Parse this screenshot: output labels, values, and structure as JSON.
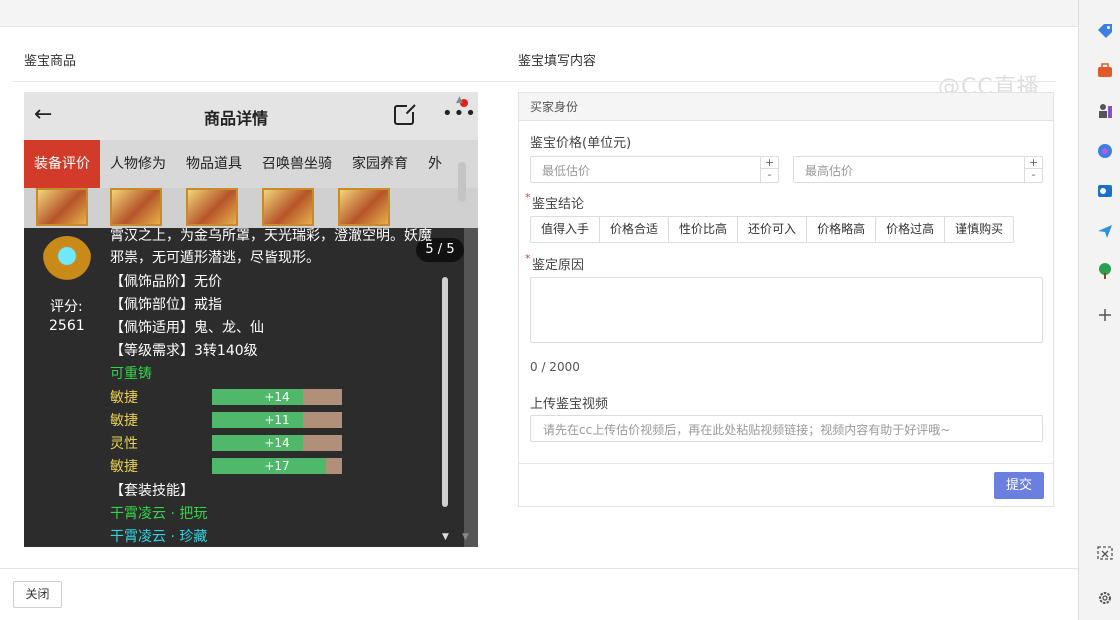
{
  "dialog": {
    "left_title": "鉴宝商品",
    "right_title": "鉴宝填写内容",
    "close_label": "关闭",
    "watermark": "@CC直播"
  },
  "phone": {
    "title": "商品详情",
    "tabs": [
      "装备评价",
      "人物修为",
      "物品道具",
      "召唤兽坐骑",
      "家园养育",
      "外"
    ],
    "active_tab": "装备评价"
  },
  "tooltip": {
    "description": "霄汉之上，为金乌所罩，天光瑞彩，澄澈空明。妖魔邪祟，无可遁形潜逃，尽皆现形。",
    "counter": "5 / 5",
    "score_label": "评分:",
    "score_value": "2561",
    "props": [
      "【佩饰品阶】无价",
      "【佩饰部位】戒指",
      "【佩饰适用】鬼、龙、仙",
      "【等级需求】3转140级"
    ],
    "recast": "可重铸",
    "stats": [
      {
        "name": "敏捷",
        "value": "+14",
        "fill": 0.7
      },
      {
        "name": "敏捷",
        "value": "+11",
        "fill": 0.7
      },
      {
        "name": "灵性",
        "value": "+14",
        "fill": 0.7
      },
      {
        "name": "敏捷",
        "value": "+17",
        "fill": 0.88
      }
    ],
    "set_title": "【套装技能】",
    "set_skills": [
      "干霄凌云 · 把玩",
      "干霄凌云 · 珍藏"
    ]
  },
  "form": {
    "section": "买家身份",
    "price_label": "鉴宝价格(单位元)",
    "min_placeholder": "最低估价",
    "max_placeholder": "最高估价",
    "conclusion_label": "鉴宝结论",
    "conclusions": [
      "值得入手",
      "价格合适",
      "性价比高",
      "还价可入",
      "价格略高",
      "价格过高",
      "谨慎购买"
    ],
    "reason_label": "鉴定原因",
    "reason_counter": "0 / 2000",
    "video_label": "上传鉴宝视频",
    "video_placeholder": "请先在cc上传估价视频后，再在此处粘贴视频链接；视频内容有助于好评哦~",
    "submit_label": "提交"
  },
  "colors": {
    "accent": "#6b7fe0",
    "active_tab": "#d23a2a",
    "required": "#e04040"
  },
  "sidebar_icons": [
    "tag-icon",
    "briefcase-icon",
    "chess-icon",
    "copilot-icon",
    "outlook-icon",
    "send-icon",
    "tree-icon",
    "plus-icon",
    "screenshot-icon",
    "settings-icon"
  ]
}
